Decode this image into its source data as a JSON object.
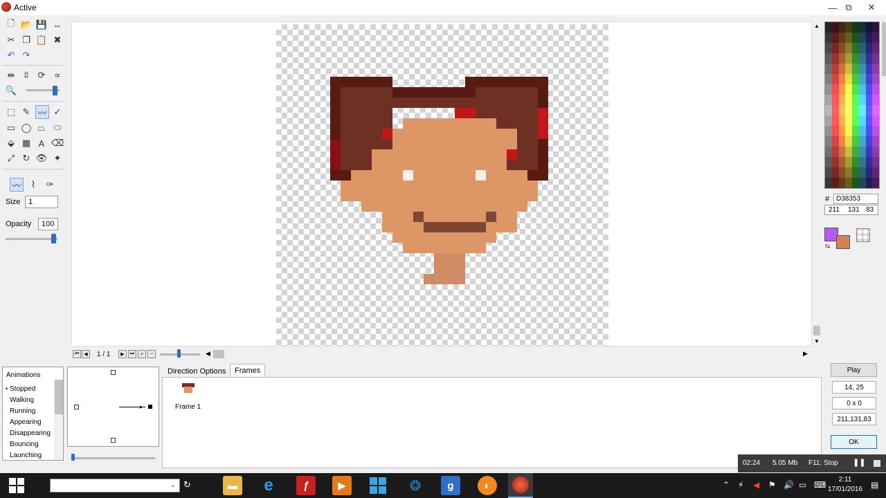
{
  "window": {
    "title": "Active",
    "minimize": "—",
    "restore": "⧉",
    "close": "✕"
  },
  "tools": {
    "size_label": "Size",
    "size_value": "1",
    "opacity_label": "Opacity",
    "opacity_value": "100"
  },
  "frame_nav": {
    "counter": "1 / 1"
  },
  "color": {
    "hash": "#",
    "hex": "D38353",
    "r": "211",
    "g": "131",
    "b": "83",
    "primary": "#b35cf0",
    "secondary": "#d38353"
  },
  "animations": {
    "header": "Animations",
    "items": [
      "Stopped",
      "Walking",
      "Running",
      "Appearing",
      "Disappearing",
      "Bouncing",
      "Launching"
    ],
    "selected": "Stopped"
  },
  "tabs": {
    "direction_options": "Direction Options",
    "frames": "Frames"
  },
  "frames": [
    {
      "label": "Frame 1"
    }
  ],
  "side": {
    "play": "Play",
    "coords": "14, 25",
    "selection": "0 x 0",
    "rgb": "211,131,83",
    "ok": "OK"
  },
  "recorder": {
    "time": "02:24",
    "size": "5.05 Mb",
    "stop": "F11: Stop"
  },
  "taskbar": {
    "clock_time": "2:11",
    "clock_date": "17/01/2016"
  },
  "palette_colors": {
    "hair_dark": "#5a1a14",
    "hair": "#6e3022",
    "hair_red": "#c01818",
    "skin": "#dd9766",
    "neck": "#cf8b63",
    "eye": "#fdefe5",
    "mouth": "#7e4634"
  }
}
